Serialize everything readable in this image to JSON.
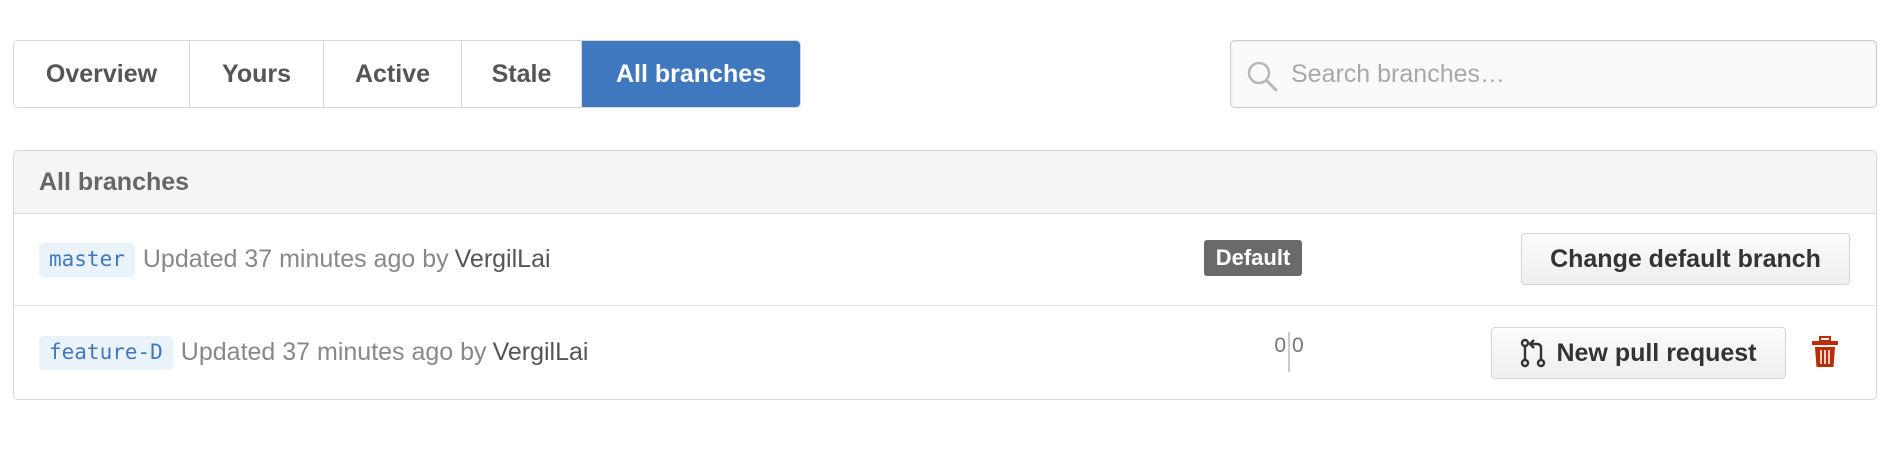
{
  "tabs": [
    {
      "label": "Overview",
      "selected": false
    },
    {
      "label": "Yours",
      "selected": false
    },
    {
      "label": "Active",
      "selected": false
    },
    {
      "label": "Stale",
      "selected": false
    },
    {
      "label": "All branches",
      "selected": true
    }
  ],
  "search": {
    "placeholder": "Search branches…",
    "value": "",
    "icon": "search-icon"
  },
  "panel": {
    "title": "All branches"
  },
  "branches": [
    {
      "name": "master",
      "updated": "Updated 37 minutes ago by",
      "author": "VergilLai",
      "badge": "Default",
      "action": "Change default branch"
    },
    {
      "name": "feature-D",
      "updated": "Updated 37 minutes ago by",
      "author": "VergilLai",
      "behind": "0",
      "ahead": "0",
      "action": "New pull request",
      "action_icon": "git-pull-request-icon",
      "delete_icon": "trash-icon"
    }
  ],
  "colors": {
    "accent": "#4078c0",
    "branch_bg": "#eaf2fa",
    "badge_bg": "#6a6a6a",
    "delete": "#bd2c00"
  }
}
